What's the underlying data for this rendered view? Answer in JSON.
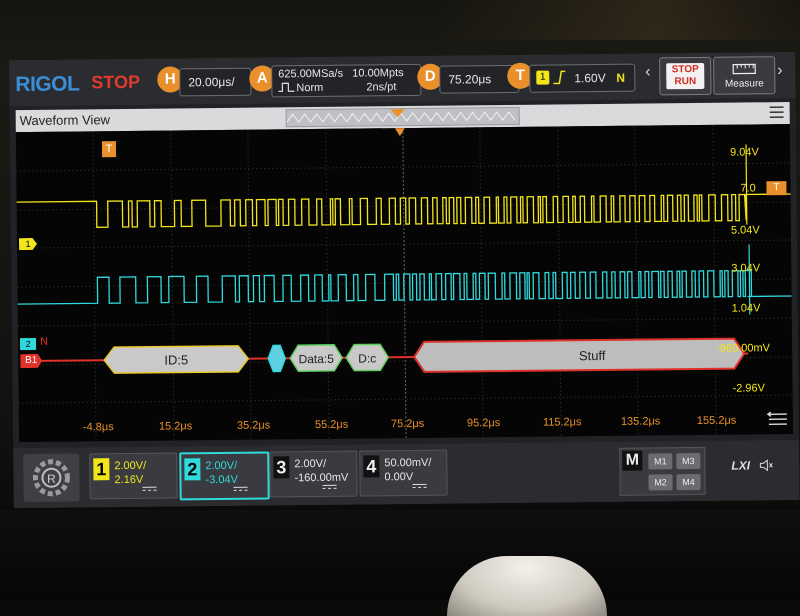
{
  "topbar": {
    "logo": "RIGOL",
    "run_state": "STOP",
    "horizontal": {
      "key": "H",
      "value": "20.00μs/"
    },
    "acquire": {
      "key": "A",
      "rate": "625.00MSa/s",
      "depth": "10.00Mpts",
      "mode": "Norm",
      "resolution": "2ns/pt"
    },
    "delay": {
      "key": "D",
      "value": "75.20μs"
    },
    "trigger": {
      "key": "T",
      "source": "1",
      "level": "1.60V",
      "mode": "N"
    },
    "stop_run": {
      "line1": "STOP",
      "line2": "RUN"
    },
    "measure": "Measure"
  },
  "waveform_view": {
    "title": "Waveform View",
    "trigger_marker": "T",
    "ch1_marker": "1",
    "ch2_marker": "2",
    "ch2_label_suffix": "N",
    "bus_marker": "B1",
    "trigger_level_marker": "7.0",
    "right_scale": [
      "9.04V",
      "7.0",
      "5.04V",
      "3.04V",
      "1.04V",
      "-960.00mV",
      "-2.96V"
    ],
    "bottom_scale": [
      "-4.8μs",
      "15.2μs",
      "35.2μs",
      "55.2μs",
      "75.2μs",
      "95.2μs",
      "115.2μs",
      "135.2μs",
      "155.2μs"
    ],
    "decode": [
      "ID:5",
      "Data:5",
      "D:c",
      "Stuff"
    ]
  },
  "channels": [
    {
      "num": "1",
      "scale": "2.00V/",
      "offset": "2.16V",
      "color": "#f2e51a"
    },
    {
      "num": "2",
      "scale": "2.00V/",
      "offset": "-3.04V",
      "color": "#2fd9dc"
    },
    {
      "num": "3",
      "scale": "2.00V/",
      "offset": "-160.00mV",
      "color": "#e6e6e6"
    },
    {
      "num": "4",
      "scale": "50.00mV/",
      "offset": "0.00V",
      "color": "#e6e6e6"
    }
  ],
  "math": {
    "label": "M",
    "items": [
      "M1",
      "M3",
      "M2",
      "M4"
    ]
  },
  "lxi": "LXI",
  "colors": {
    "ch1": "#f2e51a",
    "ch2": "#2fd9dc",
    "bus": "#e0312a",
    "accent": "#e9902a"
  }
}
